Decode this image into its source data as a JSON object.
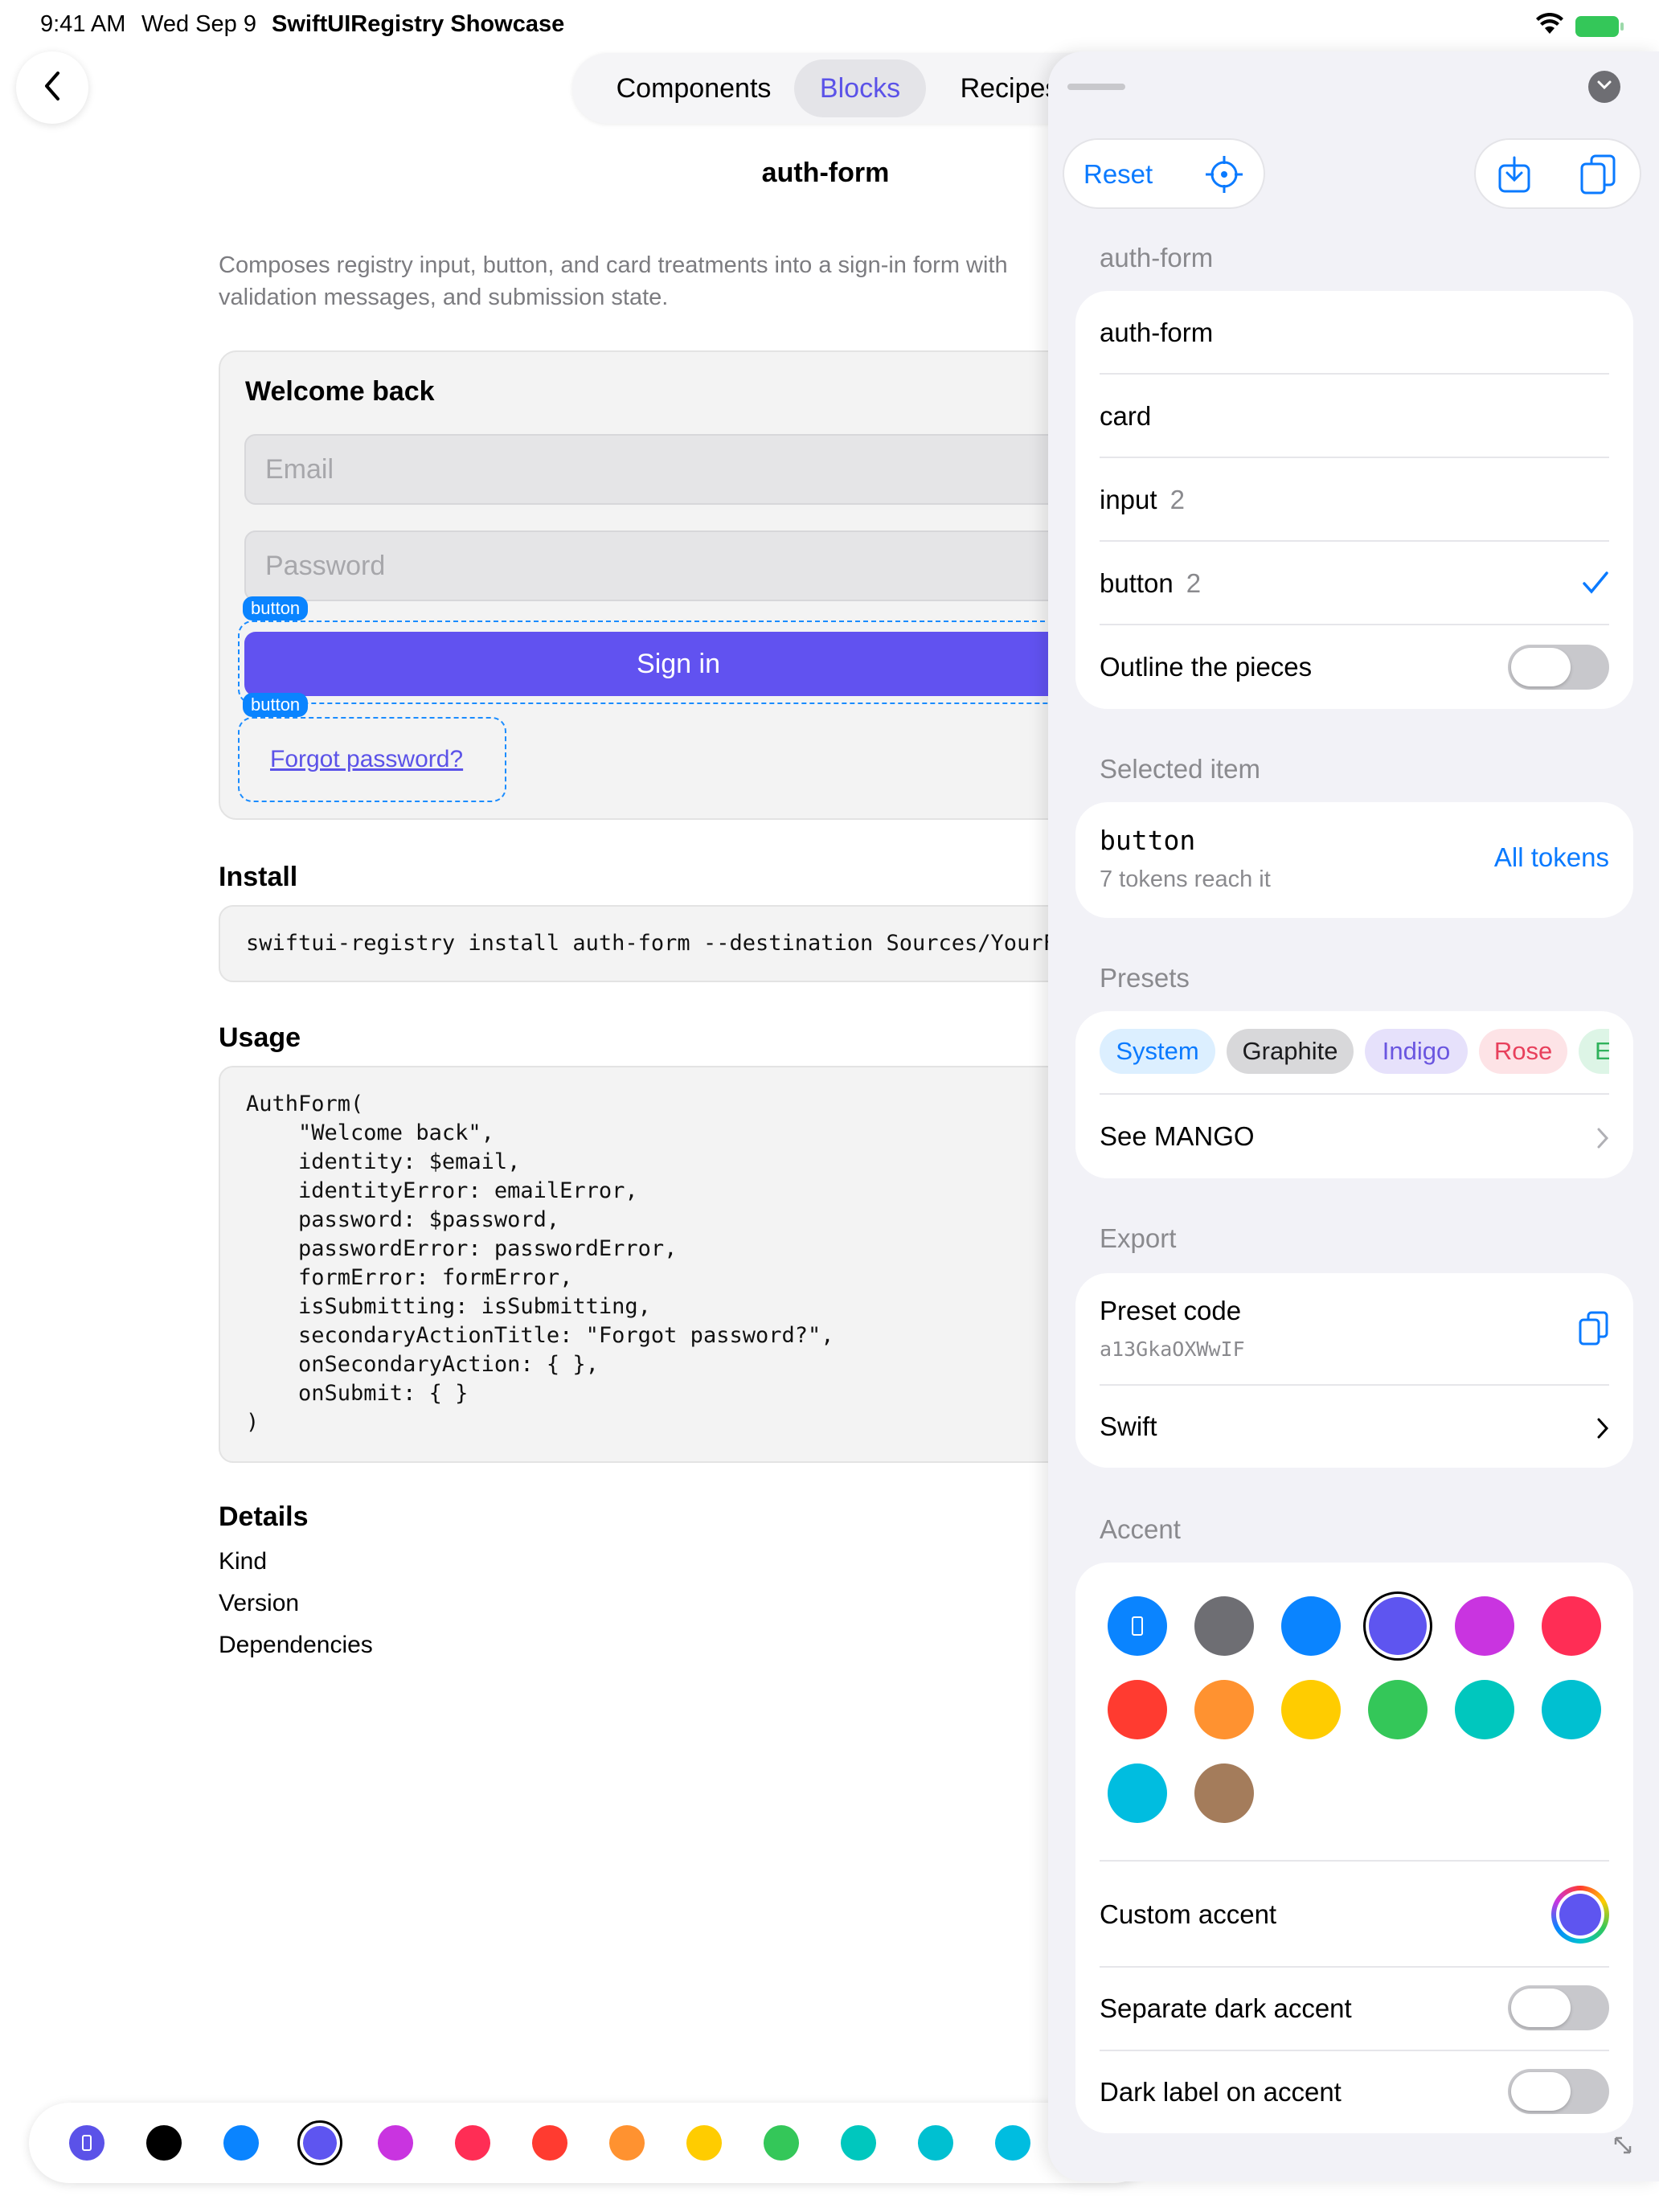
{
  "status_bar": {
    "time": "9:41 AM",
    "date": "Wed Sep 9",
    "app": "SwiftUIRegistry Showcase"
  },
  "nav": {
    "tabs": [
      {
        "label": "Components"
      },
      {
        "label": "Blocks"
      },
      {
        "label": "Recipes"
      }
    ],
    "selected_tab": "Blocks"
  },
  "page": {
    "title": "auth-form",
    "description": "Composes registry input, button, and card treatments into a sign-in form with validation messages, and submission state."
  },
  "preview": {
    "heading": "Welcome back",
    "email_placeholder": "Email",
    "password_placeholder": "Password",
    "outline_tag": "button",
    "sign_in_label": "Sign in",
    "forgot_label": "Forgot password?"
  },
  "install": {
    "heading": "Install",
    "command": "swiftui-registry install auth-form --destination Sources/YourFeature"
  },
  "usage": {
    "heading": "Usage",
    "code": "AuthForm(\n    \"Welcome back\",\n    identity: $email,\n    identityError: emailError,\n    password: $password,\n    passwordError: passwordError,\n    formError: formError,\n    isSubmitting: isSubmitting,\n    secondaryActionTitle: \"Forgot password?\",\n    onSecondaryAction: { },\n    onSubmit: { }\n)"
  },
  "details": {
    "heading": "Details",
    "rows": [
      {
        "label": "Kind"
      },
      {
        "label": "Version"
      },
      {
        "label": "Dependencies"
      }
    ]
  },
  "bottom_palette": {
    "colors": [
      "#5b52e8",
      "#000000",
      "#0a84ff",
      "#5e55f0",
      "#c934e0",
      "#ff2d55",
      "#ff3b30",
      "#ff9230",
      "#ffcc00",
      "#34c759",
      "#00c7be",
      "#00c0d1",
      "#00bde0"
    ],
    "selected_index": 3
  },
  "panel": {
    "toolbar": {
      "reset_label": "Reset"
    },
    "hierarchy": {
      "title": "auth-form",
      "items": [
        {
          "label": "auth-form",
          "count": ""
        },
        {
          "label": "card",
          "count": ""
        },
        {
          "label": "input",
          "count": "2"
        },
        {
          "label": "button",
          "count": "2",
          "checked": true
        }
      ],
      "outline_label": "Outline the pieces",
      "outline_on": false
    },
    "selected": {
      "title": "Selected item",
      "name": "button",
      "subtitle": "7 tokens reach it",
      "link": "All tokens"
    },
    "presets": {
      "title": "Presets",
      "chips": [
        {
          "label": "System",
          "bg": "#dcefff",
          "fg": "#0a7aff"
        },
        {
          "label": "Graphite",
          "bg": "#d8d8da",
          "fg": "#1c1c1e"
        },
        {
          "label": "Indigo",
          "bg": "#e6e1fb",
          "fg": "#6a56e0"
        },
        {
          "label": "Rose",
          "bg": "#fde3e6",
          "fg": "#e8405c"
        },
        {
          "label": "Emerald",
          "bg": "#ddf5e6",
          "fg": "#2fb25c"
        }
      ],
      "see_label": "See MANGO"
    },
    "export": {
      "title": "Export",
      "preset_label": "Preset code",
      "preset_value": "a13GkaOXWwIF",
      "swift_label": "Swift"
    },
    "accent": {
      "title": "Accent",
      "colors": [
        "#0a84ff",
        "#6e6e73",
        "#0a84ff",
        "#5e55f0",
        "#c934e0",
        "#ff2d55",
        "#ff3b30",
        "#ff9230",
        "#ffcc00",
        "#34c759",
        "#00c7be",
        "#00c0d1",
        "#00bde0",
        "#a47c5b"
      ],
      "selected_index": 3,
      "custom_label": "Custom accent",
      "separate_dark_label": "Separate dark accent",
      "dark_label_label": "Dark label on accent"
    }
  }
}
